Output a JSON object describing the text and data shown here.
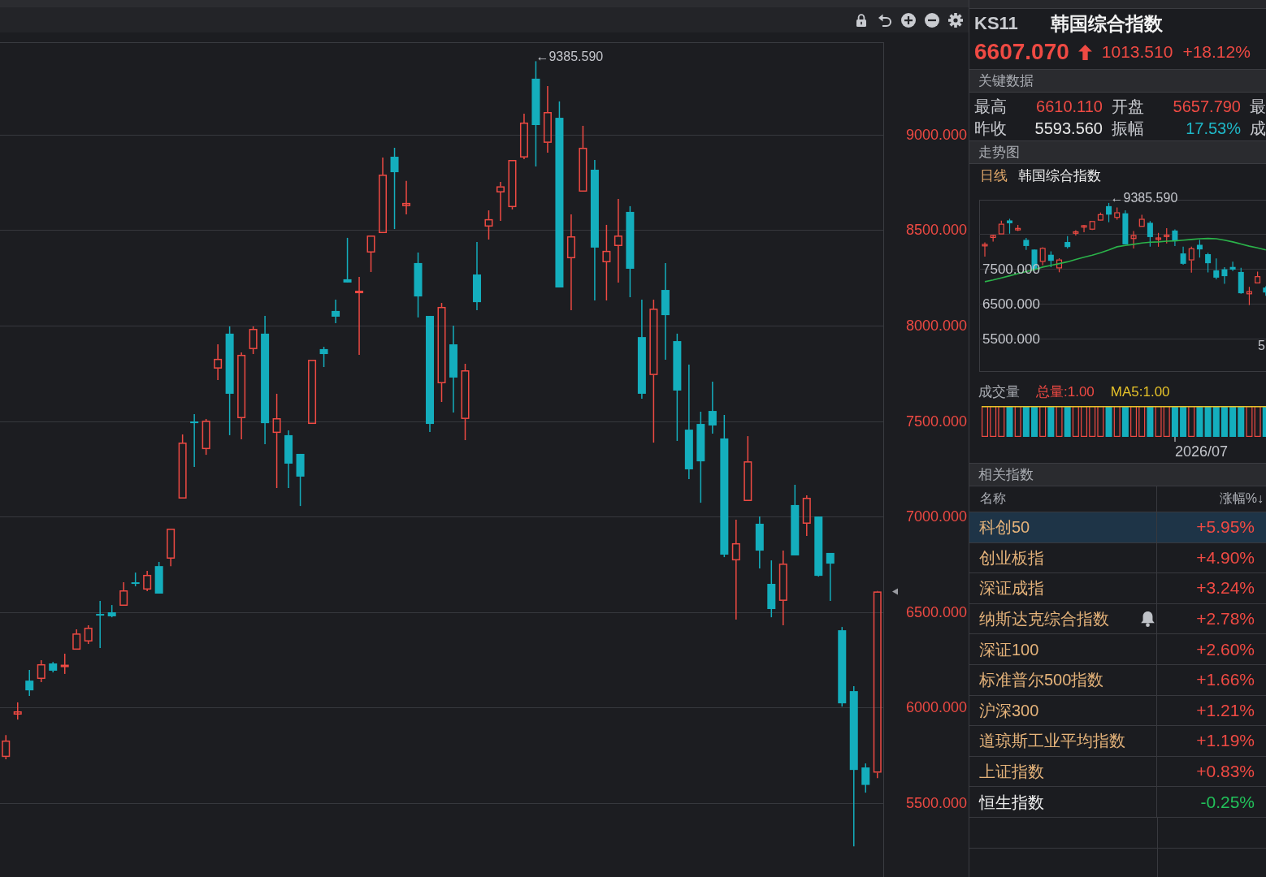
{
  "main_chart": {
    "chart_data": [
      {
        "type": "candlestick",
        "ohlc": [
          [
            5740,
            5855,
            5728,
            5826
          ],
          [
            5962,
            6026,
            5936,
            5979
          ],
          [
            6140,
            6196,
            6060,
            6089
          ],
          [
            6149,
            6247,
            6132,
            6226
          ],
          [
            6230,
            6238,
            6183,
            6192
          ],
          [
            6213,
            6281,
            6175,
            6221
          ],
          [
            6302,
            6409,
            6302,
            6387
          ],
          [
            6345,
            6430,
            6332,
            6417
          ],
          [
            6489,
            6558,
            6311,
            6481
          ],
          [
            6498,
            6536,
            6472,
            6477
          ],
          [
            6532,
            6655,
            6532,
            6613
          ],
          [
            6655,
            6706,
            6634,
            6647
          ],
          [
            6617,
            6715,
            6609,
            6694
          ],
          [
            6740,
            6762,
            6596,
            6596
          ],
          [
            6779,
            6936,
            6740,
            6936
          ],
          [
            7094,
            7430,
            7094,
            7387
          ],
          [
            7498,
            7536,
            7260,
            7489
          ],
          [
            7353,
            7511,
            7323,
            7502
          ],
          [
            7775,
            7902,
            7715,
            7826
          ],
          [
            7958,
            7996,
            7426,
            7643
          ],
          [
            7515,
            7860,
            7404,
            7847
          ],
          [
            7877,
            7996,
            7851,
            7983
          ],
          [
            7958,
            8051,
            7379,
            7489
          ],
          [
            7438,
            7643,
            7149,
            7515
          ],
          [
            7426,
            7451,
            7149,
            7277
          ],
          [
            7328,
            7328,
            7055,
            7209
          ],
          [
            7485,
            7821,
            7485,
            7821
          ],
          [
            7877,
            7889,
            7783,
            7851
          ],
          [
            8077,
            8136,
            8013,
            8047
          ],
          [
            8243,
            8460,
            8226,
            8226
          ],
          [
            8170,
            8255,
            7847,
            8183
          ],
          [
            8383,
            8472,
            8281,
            8472
          ],
          [
            8485,
            8881,
            8485,
            8791
          ],
          [
            8885,
            8932,
            8506,
            8804
          ],
          [
            8626,
            8758,
            8583,
            8643
          ],
          [
            8328,
            8383,
            8043,
            8153
          ],
          [
            8051,
            8051,
            7443,
            7485
          ],
          [
            7698,
            8119,
            7600,
            8098
          ],
          [
            7902,
            8000,
            7545,
            7728
          ],
          [
            7511,
            7800,
            7400,
            7766
          ],
          [
            8268,
            8438,
            8081,
            8123
          ],
          [
            8519,
            8604,
            8451,
            8558
          ],
          [
            8698,
            8753,
            8549,
            8730
          ],
          [
            8621,
            8868,
            8609,
            8868
          ],
          [
            8881,
            9111,
            8872,
            9064
          ],
          [
            9294,
            9385.59,
            8834,
            9051
          ],
          [
            8958,
            9255,
            8906,
            9119
          ],
          [
            9089,
            9175,
            8200,
            8200
          ],
          [
            8353,
            8583,
            8081,
            8468
          ],
          [
            8702,
            9047,
            8702,
            8932
          ],
          [
            8817,
            8868,
            8132,
            8409
          ],
          [
            8332,
            8528,
            8132,
            8392
          ],
          [
            8417,
            8664,
            8226,
            8472
          ],
          [
            8596,
            8626,
            8149,
            8298
          ],
          [
            7940,
            8136,
            7617,
            7643
          ],
          [
            7741,
            8136,
            7387,
            8089
          ],
          [
            8187,
            8328,
            7821,
            8055
          ],
          [
            7919,
            7958,
            7396,
            7660
          ],
          [
            7455,
            7796,
            7196,
            7247
          ],
          [
            7485,
            7549,
            7072,
            7289
          ],
          [
            7553,
            7706,
            7434,
            7477
          ],
          [
            7409,
            7532,
            6787,
            6800
          ],
          [
            6770,
            6983,
            6460,
            6860
          ],
          [
            7081,
            7421,
            7081,
            7289
          ],
          [
            6962,
            7000,
            6728,
            6821
          ],
          [
            6647,
            6770,
            6472,
            6515
          ],
          [
            6558,
            6821,
            6430,
            6753
          ],
          [
            7060,
            7166,
            6796,
            6796
          ],
          [
            6962,
            7111,
            6898,
            7098
          ],
          [
            7000,
            7000,
            6685,
            6689
          ],
          [
            6809,
            6809,
            6558,
            6753
          ],
          [
            6404,
            6421,
            6004,
            6021
          ],
          [
            6085,
            6111,
            5272,
            5672
          ],
          [
            5685,
            5706,
            5553,
            5593.56
          ],
          [
            5657.79,
            6610.11,
            5629.56,
            6607.07
          ]
        ],
        "ylim": [
          5111,
          9485
        ],
        "yticks": [
          {
            "value": 5500,
            "label": "5500.000"
          },
          {
            "value": 6000,
            "label": "6000.000"
          },
          {
            "value": 6500,
            "label": "6500.000"
          },
          {
            "value": 7000,
            "label": "7000.000"
          },
          {
            "value": 7500,
            "label": "7500.000"
          },
          {
            "value": 8000,
            "label": "8000.000"
          },
          {
            "value": 8500,
            "label": "8500.000"
          },
          {
            "value": 9000,
            "label": "9000.000"
          }
        ],
        "grid": true,
        "annotations": [
          "←9385.590"
        ]
      }
    ]
  },
  "quote": {
    "code": "KS11",
    "name": "韩国综合指数",
    "price": "6607.070",
    "rising": true,
    "change": "1013.510",
    "change_pct": "+18.12%"
  },
  "key_data": {
    "title": "关键数据",
    "rows": [
      [
        {
          "label": "最高",
          "value": "6610.110",
          "color": "#ef4a43"
        },
        {
          "label": "开盘",
          "value": "5657.790",
          "color": "#ef4a43"
        },
        {
          "label": "最"
        }
      ],
      [
        {
          "label": "昨收",
          "value": "5593.560",
          "color": "#e8e8e8"
        },
        {
          "label": "振幅",
          "value": "17.53%",
          "color": "#1fb8c8"
        },
        {
          "label": "成"
        }
      ]
    ]
  },
  "trend_panel": {
    "title": "走势图",
    "period": "日线",
    "name": "韩国综合指数",
    "chart_data": [
      {
        "type": "candlestick",
        "ohlc": [
          [
            8170,
            8255,
            7847,
            8183
          ],
          [
            8383,
            8472,
            8281,
            8472
          ],
          [
            8485,
            8881,
            8485,
            8791
          ],
          [
            8885,
            8932,
            8506,
            8804
          ],
          [
            8626,
            8758,
            8583,
            8643
          ],
          [
            8328,
            8383,
            8043,
            8153
          ],
          [
            8051,
            8051,
            7443,
            7485
          ],
          [
            7698,
            8119,
            7600,
            8098
          ],
          [
            7902,
            8000,
            7545,
            7728
          ],
          [
            7511,
            7800,
            7400,
            7766
          ],
          [
            8268,
            8438,
            8081,
            8123
          ],
          [
            8519,
            8604,
            8451,
            8558
          ],
          [
            8698,
            8753,
            8549,
            8730
          ],
          [
            8621,
            8868,
            8609,
            8868
          ],
          [
            8881,
            9111,
            8872,
            9064
          ],
          [
            9294,
            9385.59,
            8834,
            9051
          ],
          [
            8958,
            9255,
            8906,
            9119
          ],
          [
            9089,
            9175,
            8200,
            8200
          ],
          [
            8353,
            8583,
            8081,
            8468
          ],
          [
            8702,
            9047,
            8702,
            8932
          ],
          [
            8817,
            8868,
            8132,
            8409
          ],
          [
            8332,
            8528,
            8132,
            8392
          ],
          [
            8417,
            8664,
            8226,
            8472
          ],
          [
            8596,
            8626,
            8149,
            8298
          ],
          [
            7940,
            8136,
            7617,
            7643
          ],
          [
            7741,
            8136,
            7387,
            8089
          ],
          [
            8187,
            8328,
            7821,
            8055
          ],
          [
            7919,
            7958,
            7396,
            7660
          ],
          [
            7455,
            7796,
            7196,
            7247
          ],
          [
            7485,
            7549,
            7072,
            7289
          ],
          [
            7553,
            7706,
            7434,
            7477
          ],
          [
            7409,
            7532,
            6787,
            6800
          ],
          [
            6770,
            6983,
            6460,
            6860
          ],
          [
            7081,
            7421,
            7081,
            7289
          ],
          [
            6962,
            7000,
            6728,
            6821
          ]
        ],
        "series": [
          {
            "type": "line",
            "color": "#2bb34a",
            "values": [
              7130,
              7180,
              7240,
              7300,
              7360,
              7420,
              7480,
              7550,
              7600,
              7650,
              7700,
              7770,
              7830,
              7890,
              7960,
              8040,
              8130,
              8170,
              8200,
              8240,
              8260,
              8270,
              8290,
              8300,
              8320,
              8340,
              8360,
              8370,
              8360,
              8320,
              8270,
              8210,
              8150,
              8100,
              8040
            ]
          }
        ],
        "ylim": [
          4570,
          9477
        ],
        "yticks": [
          {
            "value": 5500,
            "label": "5500.000"
          },
          {
            "value": 6500,
            "label": "6500.000"
          },
          {
            "value": 7500,
            "label": "7500.000"
          }
        ],
        "grid": true,
        "annotations": [
          "←9385.590",
          "5"
        ]
      }
    ],
    "volume": {
      "title": "成交量",
      "legend": [
        {
          "label": "总量:1.00",
          "kind": "bars",
          "color": "#ef4a43"
        },
        {
          "label": "MA5:1.00",
          "kind": "line",
          "color": "#e6c229"
        }
      ],
      "date_label": "2026/07"
    }
  },
  "related": {
    "title": "相关指数",
    "columns": [
      "名称",
      "涨幅%↓"
    ],
    "rows": [
      {
        "name": "科创50",
        "change": "+5.95%",
        "rising": true,
        "color": "#e5b37a",
        "selected": true,
        "alert": false
      },
      {
        "name": "创业板指",
        "change": "+4.90%",
        "rising": true,
        "color": "#e5b37a",
        "selected": false,
        "alert": false
      },
      {
        "name": "深证成指",
        "change": "+3.24%",
        "rising": true,
        "color": "#e5b37a",
        "selected": false,
        "alert": false
      },
      {
        "name": "纳斯达克综合指数",
        "change": "+2.78%",
        "rising": true,
        "color": "#e5b37a",
        "selected": false,
        "alert": true
      },
      {
        "name": "深证100",
        "change": "+2.60%",
        "rising": true,
        "color": "#e5b37a",
        "selected": false,
        "alert": false
      },
      {
        "name": "标准普尔500指数",
        "change": "+1.66%",
        "rising": true,
        "color": "#e5b37a",
        "selected": false,
        "alert": false
      },
      {
        "name": "沪深300",
        "change": "+1.21%",
        "rising": true,
        "color": "#e5b37a",
        "selected": false,
        "alert": false
      },
      {
        "name": "道琼斯工业平均指数",
        "change": "+1.19%",
        "rising": true,
        "color": "#e5b37a",
        "selected": false,
        "alert": false
      },
      {
        "name": "上证指数",
        "change": "+0.83%",
        "rising": true,
        "color": "#e5b37a",
        "selected": false,
        "alert": false
      },
      {
        "name": "恒生指数",
        "change": "-0.25%",
        "rising": false,
        "color": "#eeeeee",
        "selected": false,
        "alert": false
      }
    ]
  }
}
